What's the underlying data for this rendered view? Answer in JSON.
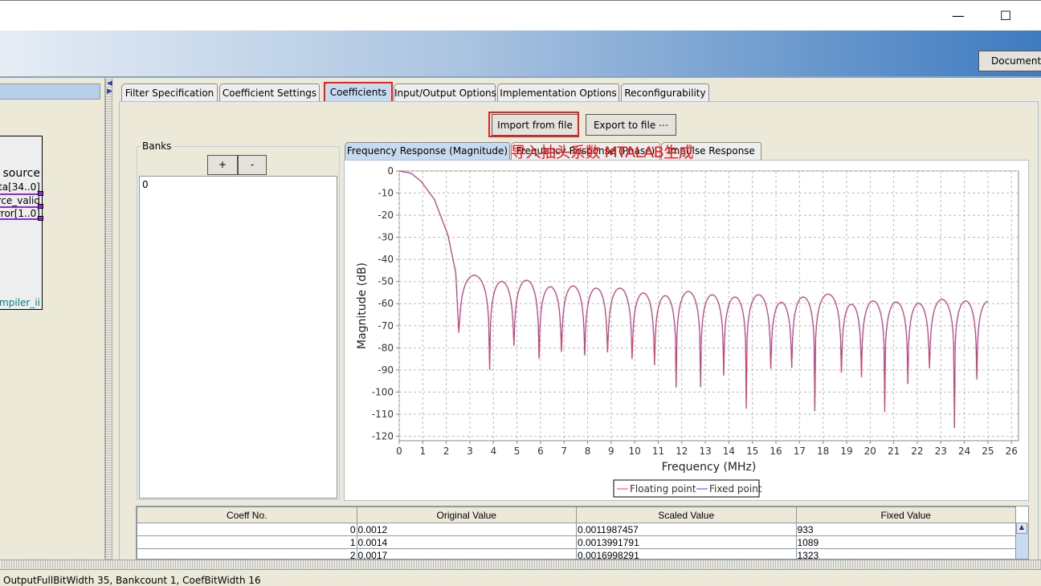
{
  "window": {
    "minimize_icon": "minimize-icon",
    "maximize_icon": "maximize-icon"
  },
  "header": {
    "doc_button": "Documenta"
  },
  "left_panel": {
    "block_ports": [
      "source",
      "ta[34..0]",
      "rce_valid",
      "rror[1..0]"
    ],
    "block_name": "mpiler_ii"
  },
  "tabs": [
    {
      "label": "Filter Specification"
    },
    {
      "label": "Coefficient Settings"
    },
    {
      "label": "Coefficients",
      "active": true
    },
    {
      "label": "Input/Output Options"
    },
    {
      "label": "Implementation Options"
    },
    {
      "label": "Reconfigurability"
    }
  ],
  "toolbar": {
    "import": "Import from file",
    "export": "Export to file ⋯"
  },
  "banks": {
    "title": "Banks",
    "add": "+",
    "remove": "-",
    "items": [
      "0"
    ]
  },
  "chart_tabs": [
    {
      "label": "Frequency Response (Magnitude)",
      "active": true
    },
    {
      "label": "Frequency Response (Phase)"
    },
    {
      "label": "Impulse Response"
    }
  ],
  "annotation": "导入抽头系数 MTALAB生成",
  "colors": {
    "highlight": "#f02020",
    "floating": "#ff4040",
    "fixed": "#4040ff"
  },
  "chart_data": {
    "type": "line",
    "title": "",
    "xlabel": "Frequency (MHz)",
    "ylabel": "Magnitude (dB)",
    "xlim": [
      0,
      26.3
    ],
    "ylim": [
      -122,
      0
    ],
    "xticks": [
      0,
      1,
      2,
      3,
      4,
      5,
      6,
      7,
      8,
      9,
      10,
      11,
      12,
      13,
      14,
      15,
      16,
      17,
      18,
      19,
      20,
      21,
      22,
      23,
      24,
      25,
      26
    ],
    "yticks": [
      0,
      -10,
      -20,
      -30,
      -40,
      -50,
      -60,
      -70,
      -80,
      -90,
      -100,
      -110,
      -120
    ],
    "grid": true,
    "legend": "bottom-center",
    "main_lobe": {
      "x": [
        0,
        0.5,
        0.93,
        1.5,
        2.07,
        2.4
      ],
      "y": [
        0,
        -1,
        -4.7,
        -13,
        -29,
        -46
      ]
    },
    "nulls": {
      "x": [
        2.53,
        3.84,
        4.87,
        5.94,
        6.89,
        7.88,
        8.85,
        9.89,
        10.84,
        11.76,
        12.8,
        13.78,
        14.74,
        15.78,
        16.67,
        17.65,
        18.78,
        19.63,
        20.62,
        21.6,
        22.52,
        23.58,
        24.53
      ],
      "y": [
        -73.1,
        -89.9,
        -79,
        -85,
        -81.8,
        -83.5,
        -82,
        -85,
        -87.8,
        -97.9,
        -97.7,
        -92.6,
        -107.5,
        -89.5,
        -89,
        -108.6,
        -91.2,
        -93.2,
        -109,
        -96.3,
        -89.3,
        -116.2,
        -94.3
      ]
    },
    "sidelobe_peaks": [
      -47.2,
      -50,
      -49.4,
      -52.4,
      -52,
      -53,
      -53,
      -55.2,
      -56.4,
      -54.5,
      -56,
      -57,
      -56,
      -59.4,
      -57,
      -55.7,
      -60.3,
      -58.8,
      -59.3,
      -59.9,
      -58.1,
      -58.8
    ],
    "end": {
      "x": 25,
      "y": -59
    },
    "series": [
      {
        "name": "Floating point",
        "color": "#ff4040"
      },
      {
        "name": "Fixed point",
        "color": "#4040ff"
      }
    ]
  },
  "table": {
    "columns": [
      "Coeff No.",
      "Original Value",
      "Scaled Value",
      "Fixed Value"
    ],
    "rows": [
      [
        "0",
        "0.0012",
        "0.0011987457",
        "933"
      ],
      [
        "1",
        "0.0014",
        "0.0013991791",
        "1089"
      ],
      [
        "2",
        "0.0017",
        "0.0016998291",
        "1323"
      ]
    ]
  },
  "status": "OutputFullBitWidth 35, Bankcount 1, CoefBitWidth 16"
}
